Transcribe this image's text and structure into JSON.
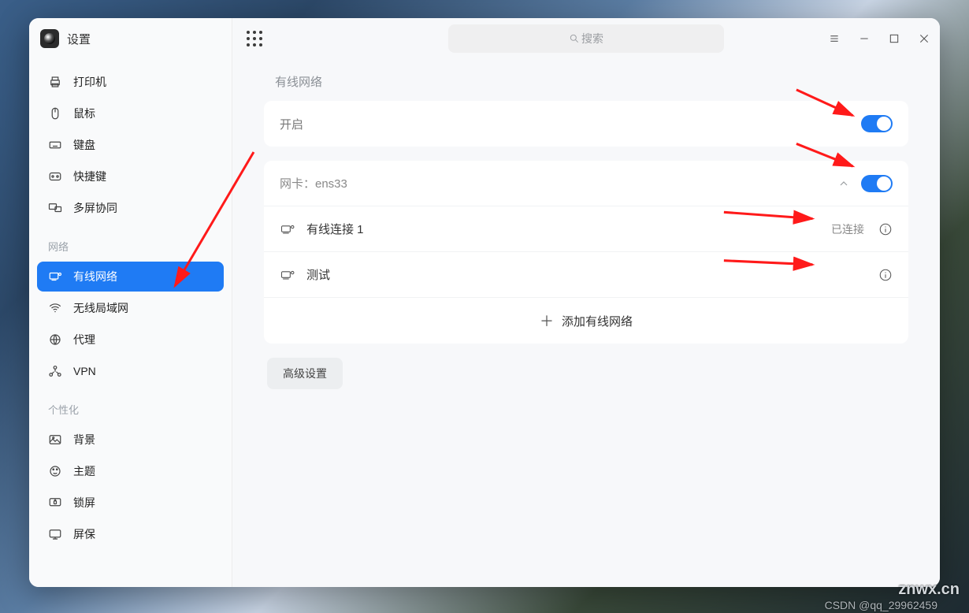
{
  "app": {
    "title": "设置"
  },
  "sidebar": {
    "groups": [
      {
        "label": null,
        "items": [
          {
            "key": "printer",
            "label": "打印机"
          },
          {
            "key": "mouse",
            "label": "鼠标"
          },
          {
            "key": "keyboard",
            "label": "键盘"
          },
          {
            "key": "shortcut",
            "label": "快捷键"
          },
          {
            "key": "multi",
            "label": "多屏协同"
          }
        ]
      },
      {
        "label": "网络",
        "items": [
          {
            "key": "wired",
            "label": "有线网络",
            "active": true
          },
          {
            "key": "wifi",
            "label": "无线局域网"
          },
          {
            "key": "proxy",
            "label": "代理"
          },
          {
            "key": "vpn",
            "label": "VPN"
          }
        ]
      },
      {
        "label": "个性化",
        "items": [
          {
            "key": "bg",
            "label": "背景"
          },
          {
            "key": "theme",
            "label": "主题"
          },
          {
            "key": "lock",
            "label": "锁屏"
          },
          {
            "key": "saver",
            "label": "屏保"
          }
        ]
      }
    ]
  },
  "search": {
    "placeholder": "搜索"
  },
  "page": {
    "section_title": "有线网络",
    "enable_label": "开启",
    "nic_label": "网卡：ens33",
    "connections": [
      {
        "name": "有线连接 1",
        "status": "已连接"
      },
      {
        "name": "测试",
        "status": ""
      }
    ],
    "add_label": "添加有线网络",
    "advanced": "高级设置"
  },
  "watermarks": {
    "top": "znwx.cn",
    "bottom": "CSDN @qq_29962459"
  }
}
